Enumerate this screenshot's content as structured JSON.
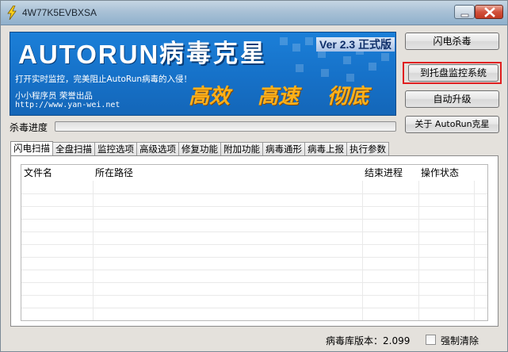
{
  "window": {
    "title": "4W77K5EVBXSA"
  },
  "banner": {
    "logo_latin": "AUTORUN",
    "logo_cn": "病毒克星",
    "version": "Ver 2.3 正式版",
    "slogan": "打开实时监控，完美阻止AutoRun病毒的入侵！",
    "author": "小小程序员 荣誉出品",
    "site": "http://www.yan-wei.net",
    "tags": [
      "高效",
      "高速",
      "彻底"
    ]
  },
  "buttons": {
    "flash_kill": "闪电杀毒",
    "to_tray": "到托盘监控系统",
    "auto_update": "自动升级",
    "about": "关于 AutoRun克星"
  },
  "progress": {
    "label": "杀毒进度",
    "value": 0
  },
  "tabs": [
    "闪电扫描",
    "全盘扫描",
    "监控选项",
    "高级选项",
    "修复功能",
    "附加功能",
    "病毒通形",
    "病毒上报",
    "执行参数"
  ],
  "active_tab": 0,
  "table": {
    "columns": [
      "文件名",
      "所在路径",
      "结束进程",
      "操作状态",
      ""
    ],
    "rows": []
  },
  "status": {
    "db_version_label": "病毒库版本：",
    "db_version": "2.099",
    "force_clear_label": "强制清除",
    "force_clear_checked": false
  },
  "colors": {
    "banner": "#1671c8",
    "tagline": "#ffb11a",
    "highlight": "#e02020"
  }
}
